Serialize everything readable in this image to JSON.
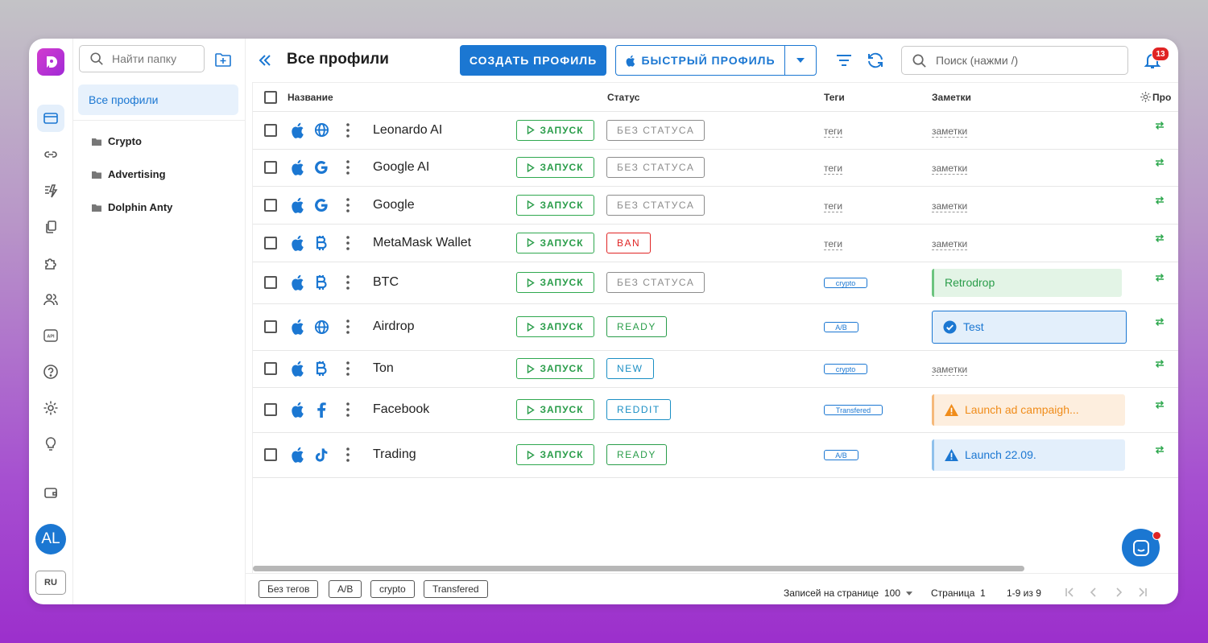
{
  "sidebar": {
    "avatar": "AL",
    "lang": "RU"
  },
  "folders": {
    "search_placeholder": "Найти папку",
    "all_label": "Все профили",
    "items": [
      "Crypto",
      "Advertising",
      "Dolphin Anty"
    ]
  },
  "header": {
    "title": "Все профили",
    "create_label": "СОЗДАТЬ ПРОФИЛЬ",
    "quick_label": "БЫСТРЫЙ ПРОФИЛЬ",
    "search_placeholder": "Поиск (нажми /)",
    "notifications": "13"
  },
  "table": {
    "columns": {
      "name": "Название",
      "status": "Статус",
      "tags": "Теги",
      "notes": "Заметки",
      "proxy": "Про"
    },
    "launch_label": "ЗАПУСК",
    "tag_placeholder": "теги",
    "note_placeholder": "заметки",
    "rows": [
      {
        "name": "Leonardo AI",
        "icon": "globe-icon",
        "status": "БЕЗ СТАТУСА",
        "status_color": "#8c8c8c",
        "tag": "",
        "note": ""
      },
      {
        "name": "Google AI",
        "icon": "google-icon",
        "status": "БЕЗ СТАТУСА",
        "status_color": "#8c8c8c",
        "tag": "",
        "note": ""
      },
      {
        "name": "Google",
        "icon": "google-icon",
        "status": "БЕЗ СТАТУСА",
        "status_color": "#8c8c8c",
        "tag": "",
        "note": ""
      },
      {
        "name": "MetaMask Wallet",
        "icon": "bitcoin-icon",
        "status": "BAN",
        "status_color": "#e02424",
        "tag": "",
        "note": ""
      },
      {
        "name": "BTC",
        "icon": "bitcoin-icon",
        "status": "БЕЗ СТАТУСА",
        "status_color": "#8c8c8c",
        "tag": "crypto",
        "note": "Retrodrop"
      },
      {
        "name": "Airdrop",
        "icon": "globe-icon",
        "status": "READY",
        "status_color": "#2a9d4a",
        "tag": "A/B",
        "note": "Test"
      },
      {
        "name": "Ton",
        "icon": "bitcoin-icon",
        "status": "NEW",
        "status_color": "#1b8fc4",
        "tag": "crypto",
        "note": ""
      },
      {
        "name": "Facebook",
        "icon": "facebook-icon",
        "status": "REDDIT",
        "status_color": "#1b8fc4",
        "tag": "Transfered",
        "note": "Launch ad campaigh..."
      },
      {
        "name": "Trading",
        "icon": "tiktok-icon",
        "status": "READY",
        "status_color": "#2a9d4a",
        "tag": "A/B",
        "note": "Launch 22.09."
      }
    ]
  },
  "footer": {
    "tags": [
      "Без тегов",
      "A/B",
      "crypto",
      "Transfered"
    ],
    "per_page_label": "Записей на странице",
    "per_page_value": "100",
    "page_label": "Страница",
    "page_value": "1",
    "range": "1-9 из 9"
  }
}
